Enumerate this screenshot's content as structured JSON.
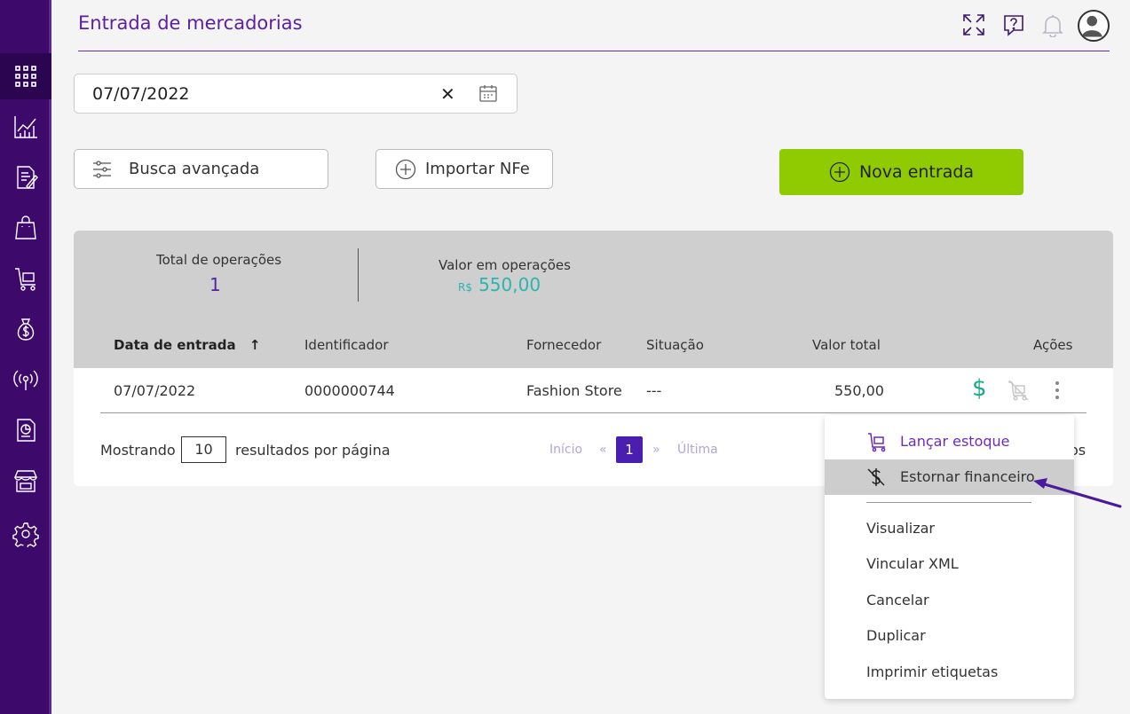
{
  "sidebar": {
    "items": [
      {
        "icon": "apps-grid-icon"
      },
      {
        "icon": "chart-icon"
      },
      {
        "icon": "document-edit-icon"
      },
      {
        "icon": "shopping-bag-icon"
      },
      {
        "icon": "cart-stock-icon"
      },
      {
        "icon": "money-bag-icon"
      },
      {
        "icon": "signal-tower-icon"
      },
      {
        "icon": "report-icon"
      },
      {
        "icon": "store-icon"
      },
      {
        "icon": "gear-icon"
      }
    ]
  },
  "header": {
    "title": "Entrada de mercadorias",
    "icons": [
      "fullscreen-icon",
      "help-chat-icon",
      "bell-icon",
      "user-avatar"
    ]
  },
  "date_filter": {
    "value": "07/07/2022",
    "clear_label": "✕"
  },
  "toolbar": {
    "advanced_search_label": "Busca avançada",
    "import_label": "Importar NFe",
    "new_entry_label": "Nova entrada"
  },
  "summary": {
    "total_ops_label": "Total de operações",
    "total_ops_value": "1",
    "value_label": "Valor em operações",
    "currency": "R$",
    "value": "550,00"
  },
  "table": {
    "columns": [
      "Data de entrada",
      "Identificador",
      "Fornecedor",
      "Situação",
      "Valor total",
      "Ações"
    ],
    "sort_indicator": "↑",
    "rows": [
      {
        "date": "07/07/2022",
        "id": "0000000744",
        "supplier": "Fashion Store",
        "status": "---",
        "total": "550,00",
        "money_symbol": "$"
      }
    ]
  },
  "pagination": {
    "showing_label": "Mostrando",
    "per_page": "10",
    "per_page_label": "resultados por página",
    "first": "Início",
    "prev": "«",
    "current": "1",
    "next": "»",
    "last": "Última",
    "trailing_text": "os"
  },
  "context_menu": {
    "items": [
      {
        "label": "Lançar estoque",
        "icon": "cart-stock-icon",
        "color": "#6b2bbf"
      },
      {
        "label": "Estornar financeiro",
        "icon": "money-off-icon",
        "highlighted": true
      },
      {
        "label": "Visualizar"
      },
      {
        "label": "Vincular XML"
      },
      {
        "label": "Cancelar"
      },
      {
        "label": "Duplicar"
      },
      {
        "label": "Imprimir etiquetas"
      }
    ]
  },
  "colors": {
    "sidebar": "#3d0a6b",
    "accent": "#5a1fa4",
    "primary_button": "#8fcb00",
    "money": "#1aa98a",
    "value_teal": "#2bb5b0",
    "annotation_arrow": "#4b1a9c"
  }
}
